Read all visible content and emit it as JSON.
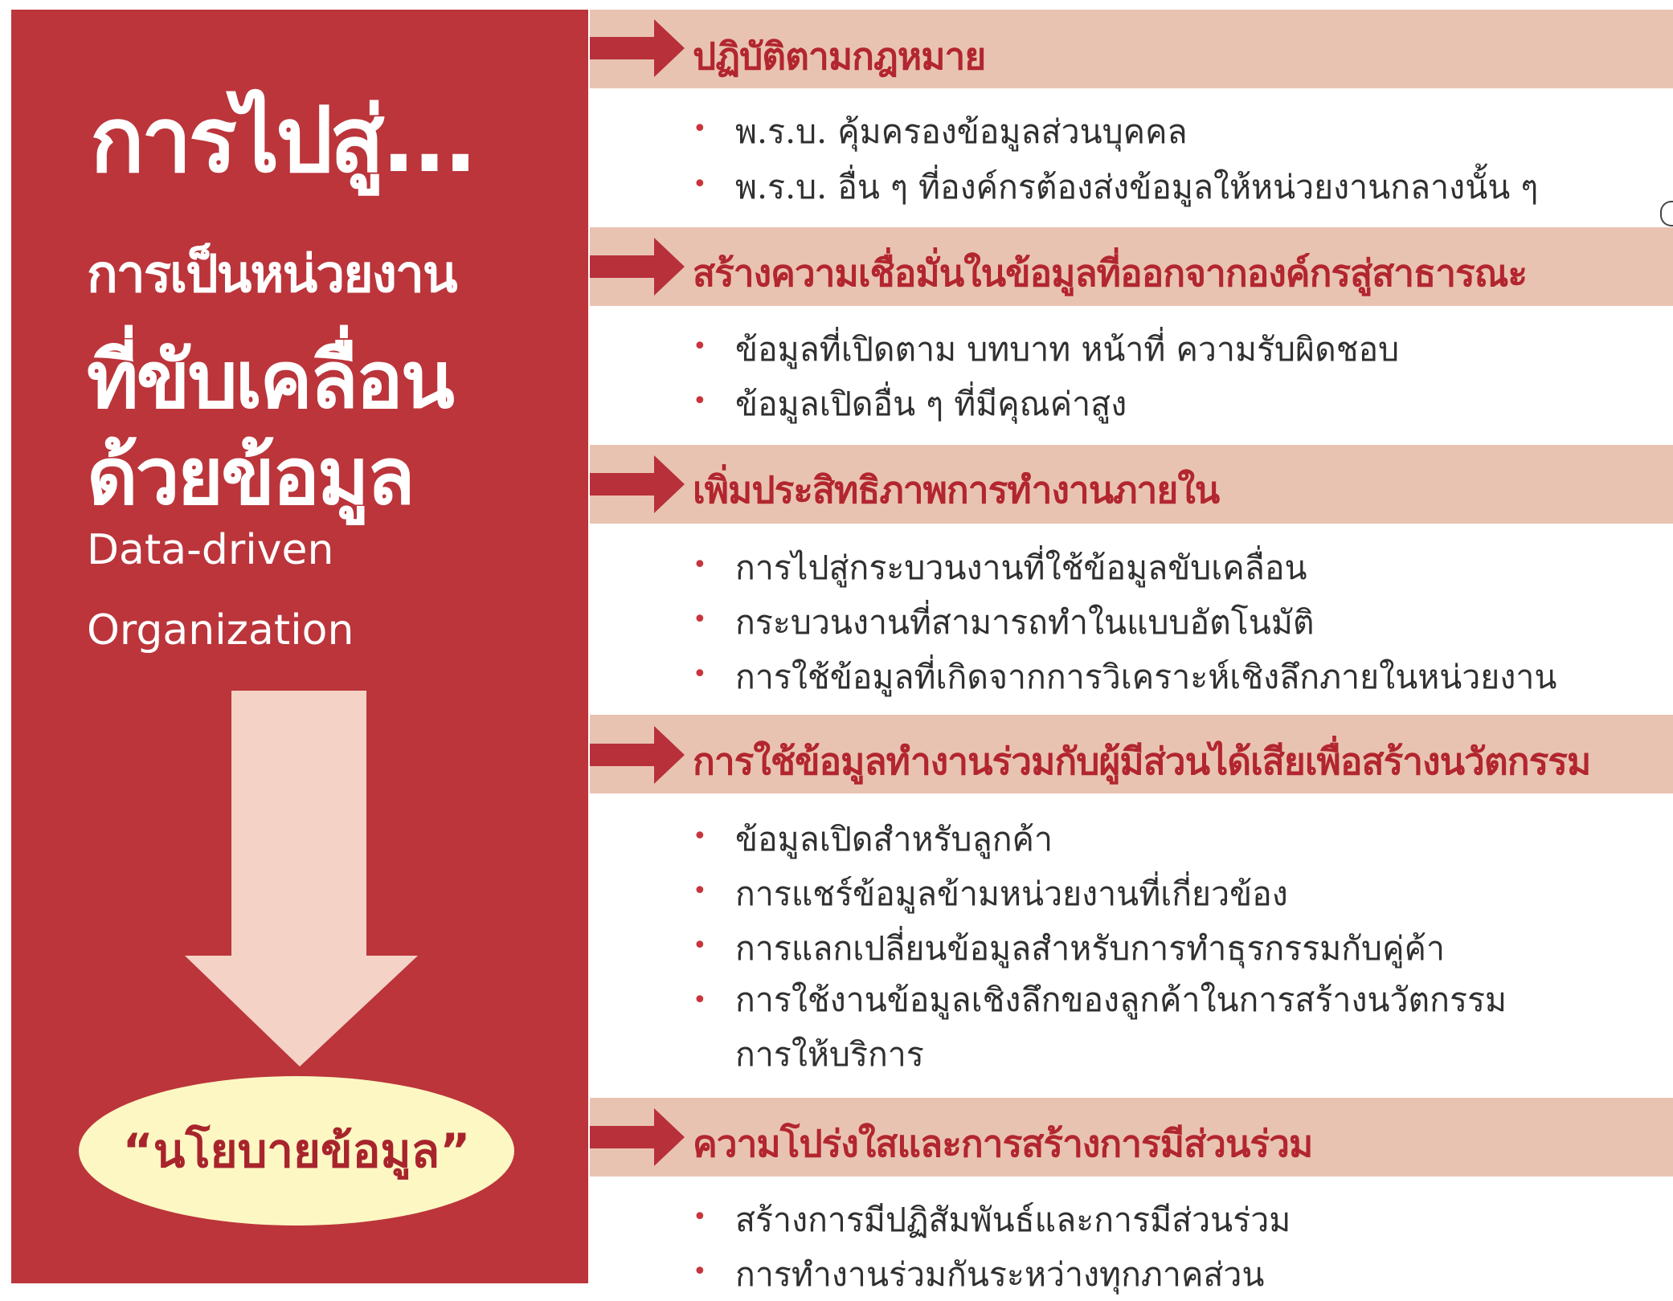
{
  "left": {
    "title_main": "การไปสู่...",
    "title_sub_1": "การเป็นหน่วยงาน",
    "title_sub_2": "ที่ขับเคลื่อน",
    "title_sub_3": "ด้วยข้อมูล",
    "title_en_1": "Data-driven",
    "title_en_2": "Organization",
    "policy_label": "“นโยบายข้อมูล”"
  },
  "sections": [
    {
      "title": "ปฏิบัติตามกฎหมาย",
      "items": [
        "พ.ร.บ. คุ้มครองข้อมูลส่วนบุคคล",
        "พ.ร.บ. อื่น ๆ ที่องค์กรต้องส่งข้อมูลให้หน่วยงานกลางนั้น ๆ"
      ]
    },
    {
      "title": "สร้างความเชื่อมั่นในข้อมูลที่ออกจากองค์กรสู่สาธารณะ",
      "items": [
        "ข้อมูลที่เปิดตาม บทบาท หน้าที่ ความรับผิดชอบ",
        "ข้อมูลเปิดอื่น ๆ ที่มีคุณค่าสูง"
      ]
    },
    {
      "title": "เพิ่มประสิทธิภาพการทำงานภายใน",
      "items": [
        "การไปสู่กระบวนงานที่ใช้ข้อมูลขับเคลื่อน",
        "กระบวนงานที่สามารถทำในแบบอัตโนมัติ",
        "การใช้ข้อมูลที่เกิดจากการวิเคราะห์เชิงลึกภายในหน่วยงาน"
      ]
    },
    {
      "title": "การใช้ข้อมูลทำงานร่วมกับผู้มีส่วนได้เสียเพื่อสร้างนวัตกรรม",
      "items": [
        "ข้อมูลเปิดสำหรับลูกค้า",
        "การแชร์ข้อมูลข้ามหน่วยงานที่เกี่ยวข้อง",
        "การแลกเปลี่ยนข้อมูลสำหรับการทำธุรกรรมกับคู่ค้า",
        "การใช้งานข้อมูลเชิงลึกของลูกค้าในการสร้างนวัตกรรม การให้บริการ"
      ]
    },
    {
      "title": "ความโปร่งใสและการสร้างการมีส่วนร่วม",
      "items": [
        "สร้างการมีปฏิสัมพันธ์และการมีส่วนร่วม",
        "การทำงานร่วมกันระหว่างทุกภาคส่วน"
      ]
    }
  ],
  "colors": {
    "panel_red": "#bb353b",
    "band_pink": "#e9c3b1",
    "arrow_pink": "#f5d2c6",
    "oval_yellow": "#fdf7c3",
    "title_red": "#b2262f",
    "bullet_red": "#c9353c"
  }
}
